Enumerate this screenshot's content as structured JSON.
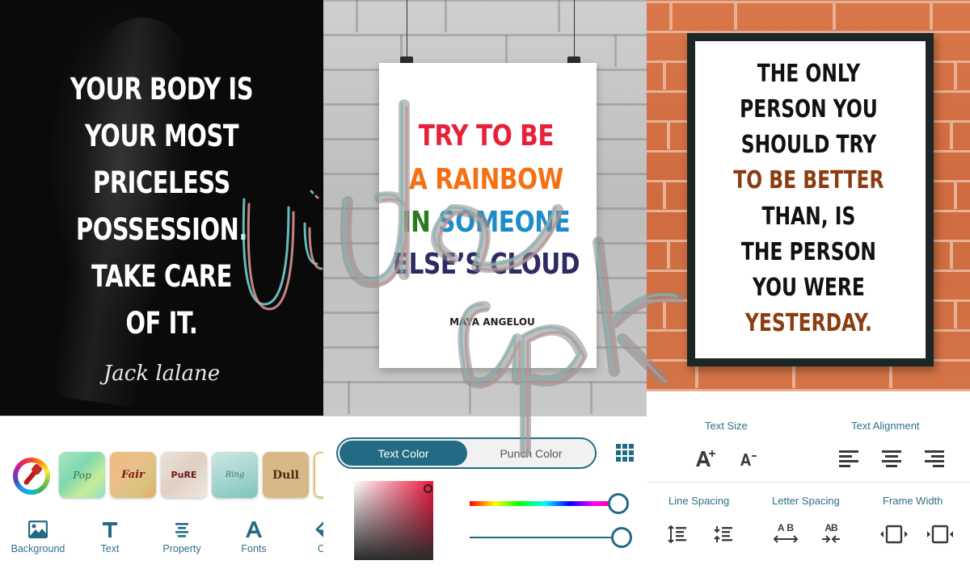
{
  "panel1": {
    "quote_lines": [
      "YOUR BODY IS",
      "YOUR MOST",
      "PRICELESS",
      "POSSESSION.",
      "TAKE CARE",
      "OF IT."
    ],
    "author": "Jack lalane",
    "color_picker_icon": "eyedropper-color-wheel-icon",
    "background_swatches": [
      {
        "label": "Pop"
      },
      {
        "label": "Fair"
      },
      {
        "label": "PuRE"
      },
      {
        "label": "Ring"
      },
      {
        "label": "Dull"
      }
    ],
    "tabs": [
      {
        "label": "Background",
        "icon": "image-icon"
      },
      {
        "label": "Text",
        "icon": "text-t-icon"
      },
      {
        "label": "Property",
        "icon": "align-center-icon"
      },
      {
        "label": "Fonts",
        "icon": "font-a-icon"
      },
      {
        "label": "Co",
        "icon": "paint-bucket-icon"
      }
    ]
  },
  "panel2": {
    "quote_lines": [
      {
        "text": "TRY TO BE",
        "color": "#e8213b"
      },
      {
        "text": "A RAINBOW",
        "color": "#f57014"
      },
      {
        "text_parts": [
          {
            "text": "IN ",
            "color": "#2a7a1e"
          },
          {
            "text": "SOMEONE",
            "color": "#1f8cc9"
          }
        ]
      },
      {
        "text": "ELSE’S CLOUD",
        "color": "#2d2b63"
      }
    ],
    "author": "MAYA ANGELOU",
    "segmented": {
      "active": "Text Color",
      "inactive": "Punch Color"
    },
    "palette_icon": "grid-palette-icon",
    "color_picker": {
      "selected_color": "#f0143a",
      "hue_position": 1.0,
      "opacity": 1.0
    }
  },
  "panel3": {
    "quote_lines": [
      {
        "text": "THE ONLY",
        "accent": false
      },
      {
        "text": "PERSON YOU",
        "accent": false
      },
      {
        "text": "SHOULD TRY",
        "accent": false
      },
      {
        "text": "TO BE BETTER",
        "accent": true
      },
      {
        "text": "THAN, IS",
        "accent": false
      },
      {
        "text": "THE PERSON",
        "accent": false
      },
      {
        "text": "YOU WERE",
        "accent": false
      },
      {
        "text": "YESTERDAY.",
        "accent": true
      }
    ],
    "accent_color": "#8b3d12",
    "text_size_label": "Text Size",
    "text_alignment_label": "Text Alignment",
    "line_spacing_label": "Line Spacing",
    "letter_spacing_label": "Letter Spacing",
    "frame_width_label": "Frame Width",
    "increase_size": "A+",
    "decrease_size": "A−",
    "letter_spacing_wide": "A B",
    "letter_spacing_narrow": "AB"
  },
  "watermark": {
    "text": "vidapk"
  },
  "theme": {
    "primary": "#236b85"
  }
}
